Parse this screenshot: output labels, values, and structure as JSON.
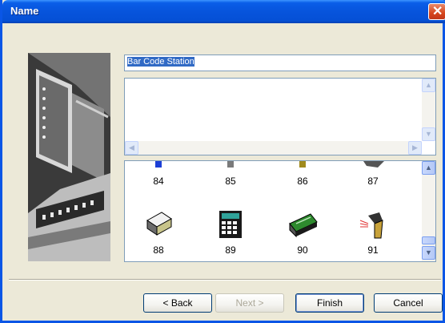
{
  "window": {
    "title": "Name"
  },
  "name_field": {
    "value": "Bar Code Station"
  },
  "icons": [
    {
      "number": "84",
      "icon": "blue-device-icon"
    },
    {
      "number": "85",
      "icon": "gray-device-icon"
    },
    {
      "number": "86",
      "icon": "olive-device-icon"
    },
    {
      "number": "87",
      "icon": "keyboard-device-icon"
    },
    {
      "number": "88",
      "icon": "stack-of-cards-icon"
    },
    {
      "number": "89",
      "icon": "calculator-icon"
    },
    {
      "number": "90",
      "icon": "green-keyboard-icon"
    },
    {
      "number": "91",
      "icon": "barcode-scanner-icon"
    }
  ],
  "buttons": {
    "back": "< Back",
    "next": "Next >",
    "finish": "Finish",
    "cancel": "Cancel"
  }
}
